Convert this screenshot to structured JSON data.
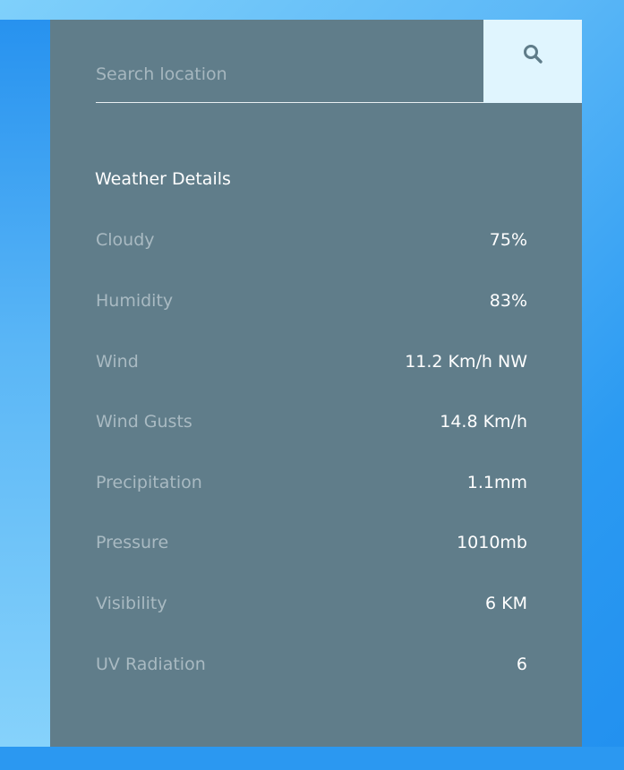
{
  "search": {
    "placeholder": "Search location",
    "icon": "search-icon"
  },
  "details": {
    "title": "Weather Details",
    "rows": [
      {
        "label": "Cloudy",
        "value": "75%"
      },
      {
        "label": "Humidity",
        "value": "83%"
      },
      {
        "label": "Wind",
        "value": "11.2 Km/h NW"
      },
      {
        "label": "Wind Gusts",
        "value": "14.8 Km/h"
      },
      {
        "label": "Precipitation",
        "value": "1.1mm"
      },
      {
        "label": "Pressure",
        "value": "1010mb"
      },
      {
        "label": "Visibility",
        "value": "6 KM"
      },
      {
        "label": "UV Radiation",
        "value": "6"
      }
    ]
  },
  "colors": {
    "panel": "#607d8a",
    "search_button": "#e0f5fe",
    "label_text": "#a9bac2",
    "value_text": "#ffffff",
    "background_gradient_light": "#7fd0fb",
    "background_gradient_dark": "#2290ef"
  }
}
